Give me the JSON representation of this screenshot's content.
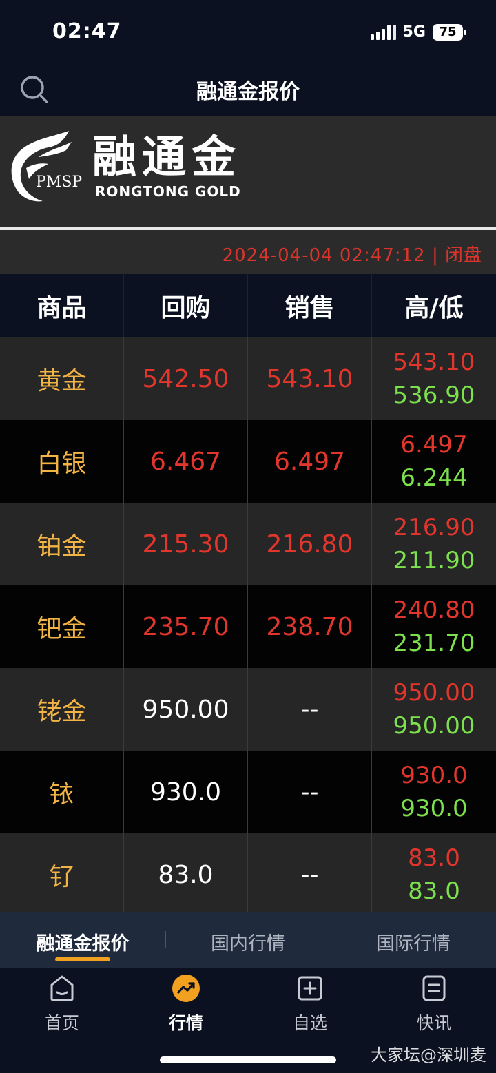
{
  "status_bar": {
    "time": "02:47",
    "network": "5G",
    "battery": "75"
  },
  "nav": {
    "title": "融通金报价"
  },
  "brand": {
    "mark_text": "PMSP",
    "name_cn": "融通金",
    "name_en": "RONGTONG GOLD"
  },
  "timebar": {
    "text": "2024-04-04 02:47:12 | 闭盘"
  },
  "table": {
    "headers": [
      "商品",
      "回购",
      "销售",
      "高/低"
    ],
    "rows": [
      {
        "name": "黄金",
        "buy": "542.50",
        "sell": "543.10",
        "high": "543.10",
        "low": "536.90"
      },
      {
        "name": "白银",
        "buy": "6.467",
        "sell": "6.497",
        "high": "6.497",
        "low": "6.244"
      },
      {
        "name": "铂金",
        "buy": "215.30",
        "sell": "216.80",
        "high": "216.90",
        "low": "211.90"
      },
      {
        "name": "钯金",
        "buy": "235.70",
        "sell": "238.70",
        "high": "240.80",
        "low": "231.70"
      },
      {
        "name": "铑金",
        "buy": "950.00",
        "sell": "--",
        "high": "950.00",
        "low": "950.00"
      },
      {
        "name": "铱",
        "buy": "930.0",
        "sell": "--",
        "high": "930.0",
        "low": "930.0"
      },
      {
        "name": "钌",
        "buy": "83.0",
        "sell": "--",
        "high": "83.0",
        "low": "83.0"
      }
    ]
  },
  "subtabs": [
    "融通金报价",
    "国内行情",
    "国际行情"
  ],
  "tabbar": [
    "首页",
    "行情",
    "自选",
    "快讯"
  ],
  "watermark": "大家坛@深圳麦",
  "colors": {
    "red": "#e2362d",
    "green": "#7ce14d",
    "gold": "#f2b445",
    "accent": "#f2a020"
  }
}
